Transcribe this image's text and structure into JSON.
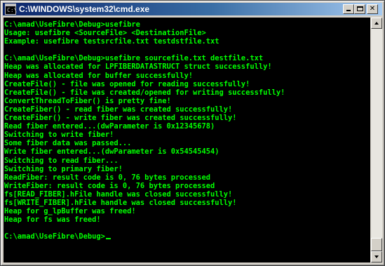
{
  "window": {
    "title": "C:\\WINDOWS\\system32\\cmd.exe",
    "icon": "console-icon",
    "icon_glyph": "C:\\",
    "buttons": {
      "minimize": "minimize-icon",
      "maximize": "maximize-icon",
      "close_glyph": "✕"
    }
  },
  "colors": {
    "console_background": "#000000",
    "console_text": "#00ff00",
    "title_gradient_start": "#0a246a",
    "title_gradient_end": "#a6caf0"
  },
  "console": {
    "lines": [
      "C:\\amad\\UseFibre\\Debug>usefibre",
      "Usage: usefibre <SourceFile> <DestinationFile>",
      "Example: usefibre testsrcfile.txt testdstfile.txt",
      "",
      "C:\\amad\\UseFibre\\Debug>usefibre sourcefile.txt destfile.txt",
      "Heap was allocated for LPFIBERDATASTRUCT struct successfully!",
      "Heap was allocated for buffer successfully!",
      "CreateFile() - file was opened for reading successfully!",
      "CreateFile() - file was created/opened for writing successfully!",
      "ConvertThreadToFiber() is pretty fine!",
      "CreateFiber() - read fiber was created successfully!",
      "CreateFiber() - write fiber was created successfully!",
      "Read fiber entered...(dwParameter is 0x12345678)",
      "Switching to write fiber!",
      "Some fiber data was passed...",
      "Write fiber entered...(dwParameter is 0x54545454)",
      "Switching to read fiber...",
      "Switching to primary fiber!",
      "ReadFiber: result code is 0, 76 bytes processed",
      "WriteFiber: result code is 0, 76 bytes processed",
      "fs[READ_FIBER].hFile handle was closed successfully!",
      "fs[WRITE_FIBER].hFile handle was closed successfully!",
      "Heap for g_lpBuffer was freed!",
      "Heap for fs was freed!",
      "",
      "C:\\amad\\UseFibre\\Debug>"
    ]
  },
  "scrollbar": {
    "up_icon": "scroll-up-arrow-icon",
    "down_icon": "scroll-down-arrow-icon",
    "position": 1.0
  }
}
